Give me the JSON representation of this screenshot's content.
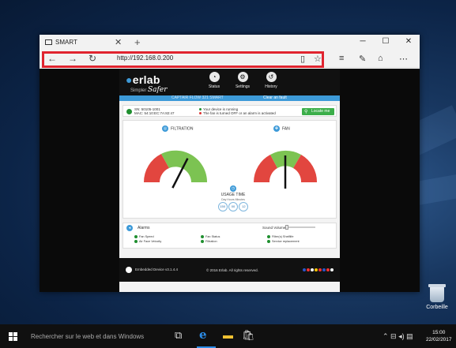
{
  "browser": {
    "tab_title": "SMART",
    "url": "http://192.168.0.200"
  },
  "site": {
    "logo": "erlab",
    "logo_sub_prefix": "Simpler",
    "logo_sub_word": "Safer",
    "nav": [
      "Status",
      "Settings",
      "History"
    ],
    "product": "CAPTAIR FLOW 321 SMART",
    "clear_fault": "Clear an fault"
  },
  "device": {
    "sn": "SN: 50105-1001",
    "mac": "MAC: 54:10:EC:7A:82:47",
    "msg1": "Your device is running",
    "msg2": "The fan is turned OFF or an alarm is activated",
    "locate": "Locate me"
  },
  "gauges": {
    "filtration": "FILTRATION",
    "fan": "FAN",
    "filtration_level": 0.65,
    "fan_level": 0.5
  },
  "usage": {
    "title": "USAGE TIME",
    "labels": "Day   Hours   Minutes",
    "days": "150",
    "hours": "00",
    "minutes": "12"
  },
  "alarms": {
    "title": "Alarms",
    "sound": "Sound Volume",
    "items": [
      "Fan Speed",
      "Air Face Velocity",
      "Fan Status",
      "Filtration",
      "Filter(s) Shelflife",
      "Service replacement"
    ]
  },
  "footer": {
    "firmware": "Embedded Device v3.1.4.4",
    "copyright": "© 2016 Erlab. All rights reserved."
  },
  "desktop": {
    "recycle": "Corbeille"
  },
  "taskbar": {
    "search": "Rechercher sur le web et dans Windows",
    "time": "15:00",
    "date": "22/02/2017"
  },
  "colors": {
    "accent": "#3d9ad8",
    "highlight": "#e0242f",
    "gauge_red": "#e2463f",
    "gauge_green": "#7cc352",
    "edge": "#2c8ce6"
  }
}
